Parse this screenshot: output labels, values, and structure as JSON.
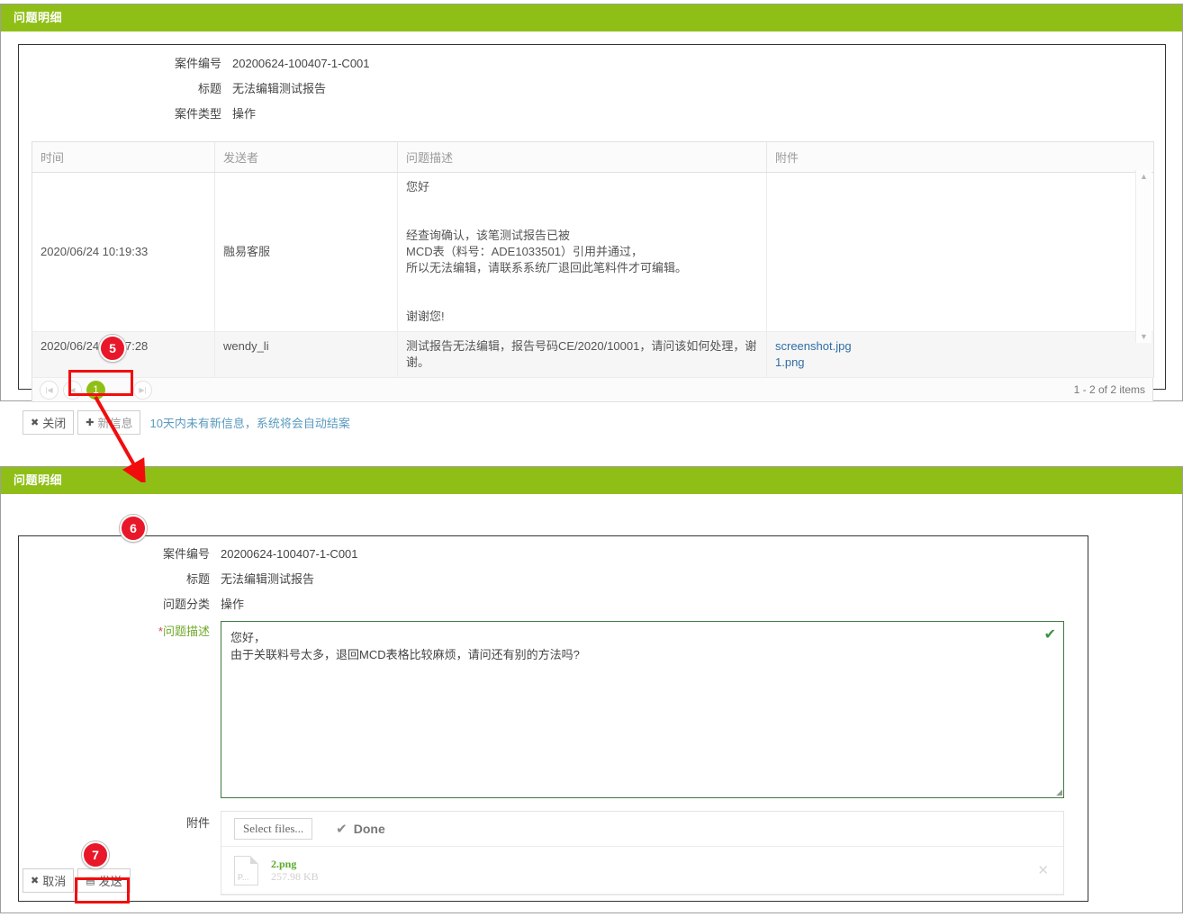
{
  "top_panel": {
    "title": "问题明细",
    "fields": [
      {
        "label": "案件编号",
        "value": "20200624-100407-1-C001"
      },
      {
        "label": "标题",
        "value": "无法编辑测试报告"
      },
      {
        "label": "案件类型",
        "value": "操作"
      }
    ],
    "grid": {
      "columns": [
        "时间",
        "发送者",
        "问题描述",
        "附件"
      ],
      "rows": [
        {
          "time": "2020/06/24 10:19:33",
          "sender": "融易客服",
          "description": "您好\n\n\n经查询确认，该笔测试报告已被\nMCD表（料号：ADE1033501）引用并通过，\n所以无法编辑，请联系系统厂退回此笔料件才可编辑。\n\n\n谢谢您!",
          "attachments": []
        },
        {
          "time": "2020/06/24 10:07:28",
          "sender": "wendy_li",
          "description": "测试报告无法编辑，报告号码CE/2020/10001，请问该如何处理，谢谢。",
          "attachments": [
            "screenshot.jpg",
            "1.png"
          ]
        }
      ]
    },
    "pager": {
      "first_icon": "first-page-icon",
      "prev_icon": "prev-page-icon",
      "current_page": "1",
      "next_icon": "next-page-icon",
      "info": "1 - 2 of 2 items"
    },
    "toolbar": {
      "close_label": "关闭",
      "close_icon": "✖",
      "new_message_label": "新信息",
      "new_message_icon": "✚",
      "hint": "10天内未有新信息，系统将会自动结案"
    }
  },
  "bottom_panel": {
    "title": "问题明细",
    "fields": [
      {
        "label": "案件编号",
        "value": "20200624-100407-1-C001"
      },
      {
        "label": "标题",
        "value": "无法编辑测试报告"
      },
      {
        "label": "问题分类",
        "value": "操作"
      }
    ],
    "description_field": {
      "label": "问题描述",
      "required_mark": "*",
      "value": "您好，\n由于关联料号太多，退回MCD表格比较麻烦，请问还有别的方法吗?",
      "valid_icon": "✔"
    },
    "attachment_field": {
      "label": "附件",
      "select_files_label": "Select files...",
      "done_label": "Done",
      "done_icon": "✔",
      "remove_icon": "✕",
      "files": [
        {
          "icon_text": "P...",
          "name": "2.png",
          "size": "257.98 KB"
        }
      ]
    },
    "toolbar": {
      "cancel_label": "取消",
      "cancel_icon": "✖",
      "send_label": "发送",
      "send_icon": "▤"
    }
  },
  "annotations": {
    "markers": [
      {
        "id": "5",
        "label": "5"
      },
      {
        "id": "6",
        "label": "6"
      },
      {
        "id": "7",
        "label": "7"
      }
    ],
    "colors": {
      "marker": "#e8182a",
      "highlight": "#f20d0d",
      "header": "#8fbf17",
      "link": "#2f6ea5",
      "hint": "#5a9bbf"
    }
  }
}
